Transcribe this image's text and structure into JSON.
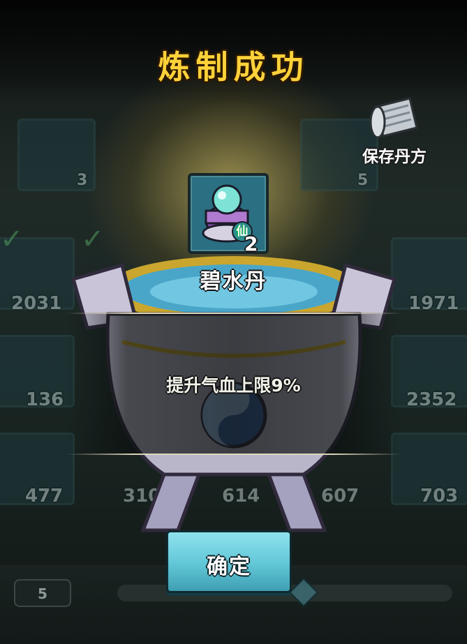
{
  "title": "炼制成功",
  "save_recipe": {
    "label": "保存丹方"
  },
  "result_item": {
    "name": "碧水丹",
    "quantity": "2",
    "badge": "仙"
  },
  "description": "提升气血上限9%",
  "confirm_button": {
    "label": "确定"
  },
  "background_counts": [
    "3",
    "5",
    "2031",
    "1971",
    "136",
    "2352",
    "477",
    "310",
    "614",
    "607",
    "703"
  ],
  "bottom": {
    "quantity": "5"
  },
  "colors": {
    "title": "#ffd23a",
    "button": "#60c6d6",
    "frame": "#2b6f82"
  }
}
